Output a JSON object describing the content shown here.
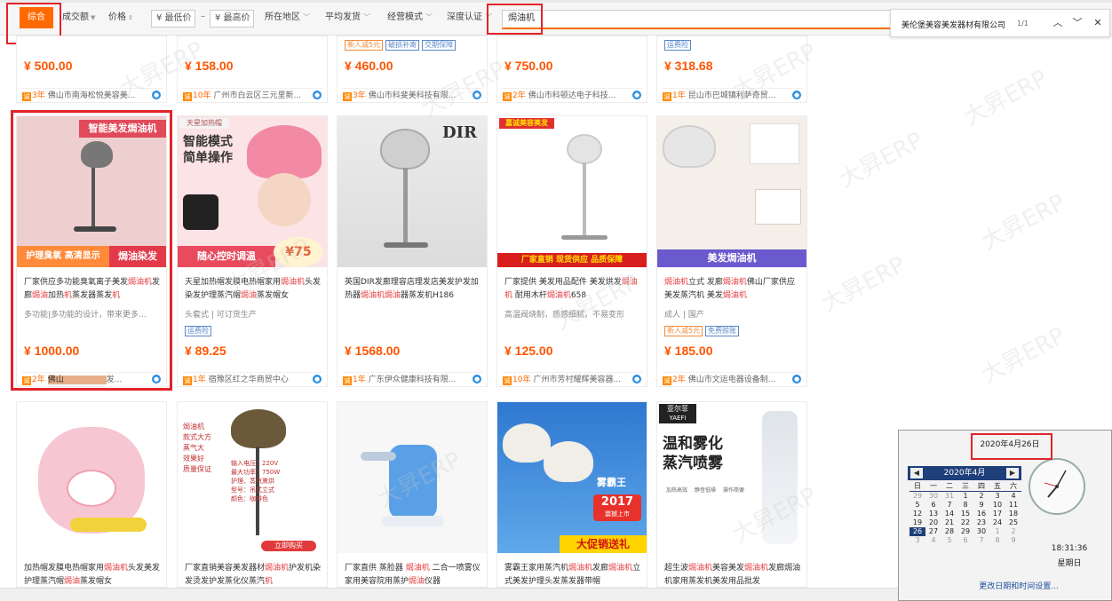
{
  "filterbar": {
    "sort_general": "综合",
    "sort_volume": "成交额",
    "sort_price": "价格",
    "min_price": "¥ 最低价",
    "dash": "–",
    "max_price": "¥ 最高价",
    "region": "所在地区",
    "avg_ship": "平均发货",
    "biz_mode": "经营模式",
    "deep_cert": "深度认证",
    "search_value": "焗油机"
  },
  "findbar": {
    "query": "美伦堡美容美发器材有限公司",
    "count": "1/1"
  },
  "row1": [
    {
      "price": "¥ 500.00",
      "years": "3年",
      "shop": "佛山市南海松悦美容美...",
      "tags": []
    },
    {
      "price": "¥ 158.00",
      "years": "10年",
      "shop": "广州市白云区三元里新...",
      "tags": []
    },
    {
      "price": "¥ 460.00",
      "years": "3年",
      "shop": "佛山市科斐美科技有限...",
      "tags": [
        "新人减5元",
        "破损补寄",
        "交期保障"
      ]
    },
    {
      "price": "¥ 750.00",
      "years": "2年",
      "shop": "佛山市科顿达电子科技...",
      "tags": []
    },
    {
      "price": "¥ 318.68",
      "years": "1年",
      "shop": "昆山市巴城镇利萨奇贸...",
      "tags": [
        "运费险"
      ]
    }
  ],
  "row2": [
    {
      "img_top": "智能美发焗油机",
      "img_left": "护理臭氧 高清显示",
      "img_right": "焗油染发",
      "title_a": "厂家供应多功能臭氧离子美发",
      "title_hl1": "焗油机",
      "title_b": "发廊",
      "title_hl2": "焗油",
      "title_c": "加热",
      "title_hl3": "机",
      "title_d": "蒸发器蒸发",
      "title_hl4": "机",
      "sub": "多功能|多功能的设计，带来更多...",
      "price": "¥ 1000.00",
      "years": "2年",
      "shop": "佛山",
      "shop_tail": "发..."
    },
    {
      "img_badge": "天星加热帽",
      "img_head1": "智能模式",
      "img_head2": "简单操作",
      "img_bottom": "随心控时调温",
      "img_price": "¥75",
      "title_a": "天星加热帽发膜电热帽家用",
      "title_hl1": "焗油机",
      "title_b": "头发染发护理蒸汽帽",
      "title_hl2": "焗油",
      "title_c": "蒸发帽女",
      "sub": "头套式 | 可订货生产",
      "tag": "运费险",
      "price": "¥ 89.25",
      "years": "1年",
      "shop": "宿豫区红之华商贸中心"
    },
    {
      "img_text": "DIR",
      "title_a": "英国DIR发廊理容店理发店美发护发加热器",
      "title_hl1": "焗油机",
      "title_hl2": "焗油",
      "title_b": "器蒸发机H186",
      "price": "¥ 1568.00",
      "years": "1年",
      "shop": "广东伊众健康科技有限..."
    },
    {
      "img_top": "嘉诚美容美发",
      "img_bottom": "厂家直销 现货供应 品质保障",
      "title_a": "厂家提供 美发用品配件 美发烘发",
      "title_hl1": "焗油机",
      "title_b": " 耐用木杆",
      "title_hl2": "焗油机",
      "title_c": "658",
      "sub": "高温阀烧制，质感细腻，不易变形",
      "price": "¥ 125.00",
      "years": "10年",
      "shop": "广州市芳村耀辉美容器..."
    },
    {
      "img_bottom": "美发焗油机",
      "title_hl1": "焗油机",
      "title_a": "立式 发廊",
      "title_hl2": "焗油机",
      "title_b": "佛山厂家供应 美发蒸汽机 美发",
      "title_hl3": "焗油机",
      "sub": "成人 | 国产",
      "tags": [
        "新人减5元",
        "免费赊账"
      ],
      "price": "¥ 185.00",
      "years": "2年",
      "shop": "佛山市文运电器设备制..."
    }
  ],
  "row3": [
    {
      "title_a": "加热帽发膜电热帽家用",
      "title_hl1": "焗油机",
      "title_b": "头发美发护理蒸汽帽",
      "title_hl2": "焗油",
      "title_c": "蒸发帽女"
    },
    {
      "img_lines": [
        "焗油机",
        "款式大方",
        "蒸气大",
        "效果好",
        "质量保证"
      ],
      "img_specs": [
        "输入电压：220V",
        "最大功率：750W",
        "护理、蒸汽熏烘",
        "型号：吊式立式",
        "颜色：咖啡色"
      ],
      "img_btn": "立即购买",
      "title_a": "厂家直销美容美发器材",
      "title_hl1": "焗油机",
      "title_b": "护发机染发烫发护发蒸化仪蒸汽",
      "title_hl2": "机"
    },
    {
      "title_a": "厂家直供 蒸脸器 ",
      "title_hl1": "焗油机",
      "title_b": " 二合一喷雾仪 家用美容院用蒸护",
      "title_hl2": "焗油",
      "title_c": "仪器"
    },
    {
      "img_brand": "雾霸王",
      "img_year": "2017",
      "img_year_sub": "震撼上市",
      "img_bottom": "大促销送礼",
      "title_a": "雾霸王家用蒸汽机",
      "title_hl1": "焗油机",
      "title_b": "发廊",
      "title_hl2": "焗油机",
      "title_c": "立式美发护理头发蒸发器带帽"
    },
    {
      "img_brand": "亚尔菲",
      "img_brand_en": "YAEFI",
      "img_head1": "温和雾化",
      "img_head2": "蒸汽喷雾",
      "img_icons": [
        "加热高效",
        "静音低噪",
        "操作简便"
      ],
      "title_a": "超生波",
      "title_hl1": "焗油机",
      "title_b": "美容美发",
      "title_hl2": "焗油机",
      "title_c": "发廊焗油机家用蒸发机美发用品批发"
    }
  ],
  "watermark": "大昇ERP",
  "calendar": {
    "date_header": "2020年4月26日",
    "month_label": "2020年4月",
    "weekdays": [
      "日",
      "一",
      "二",
      "三",
      "四",
      "五",
      "六"
    ],
    "weeks": [
      [
        "29",
        "30",
        "31",
        "1",
        "2",
        "3",
        "4"
      ],
      [
        "5",
        "6",
        "7",
        "8",
        "9",
        "10",
        "11"
      ],
      [
        "12",
        "13",
        "14",
        "15",
        "16",
        "17",
        "18"
      ],
      [
        "19",
        "20",
        "21",
        "22",
        "23",
        "24",
        "25"
      ],
      [
        "26",
        "27",
        "28",
        "29",
        "30",
        "1",
        "2"
      ],
      [
        "3",
        "4",
        "5",
        "6",
        "7",
        "8",
        "9"
      ]
    ],
    "selected_day": "26",
    "time": "18:31:36",
    "weekday": "星期日",
    "settings_link": "更改日期和时间设置..."
  }
}
